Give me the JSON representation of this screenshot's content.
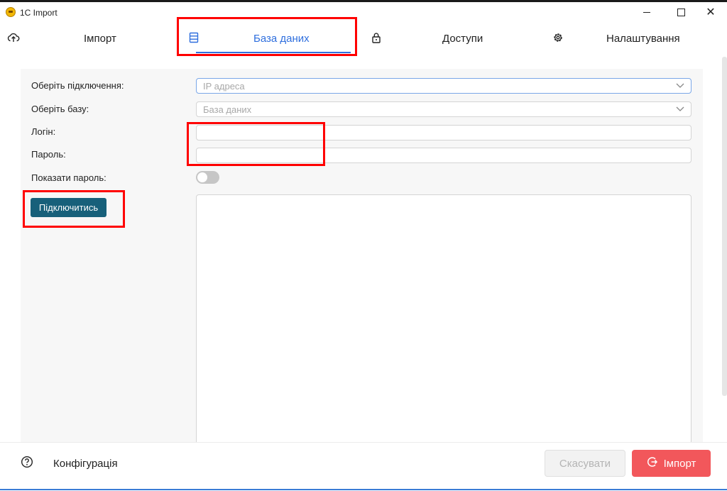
{
  "window": {
    "title": "1C Import",
    "min_symbol": "",
    "close_symbol": "✕"
  },
  "nav": {
    "tabs": [
      {
        "label": "Імпорт",
        "icon": "cloud-upload-icon"
      },
      {
        "label": "База даних",
        "icon": "database-icon",
        "active": true
      },
      {
        "label": "Доступи",
        "icon": "lock-icon"
      },
      {
        "label": "Налаштування",
        "icon": "gear-icon"
      }
    ],
    "active_color": "#2f6fde"
  },
  "form": {
    "connection_label": "Оберіть підключення:",
    "connection_placeholder": "IP адреса",
    "database_label": "Оберіть базу:",
    "database_placeholder": "База даних",
    "login_label": "Логін:",
    "login_value": "",
    "password_label": "Пароль:",
    "password_value": "",
    "show_password_label": "Показати пароль:",
    "show_password_on": false,
    "connect_button": "Підключитись",
    "connect_color": "#17607a"
  },
  "footer": {
    "config_label": "Конфігурація",
    "cancel_button": "Скасувати",
    "import_button": "Імпорт",
    "import_color": "#f2575b"
  },
  "annotation_color": "#ff0000"
}
